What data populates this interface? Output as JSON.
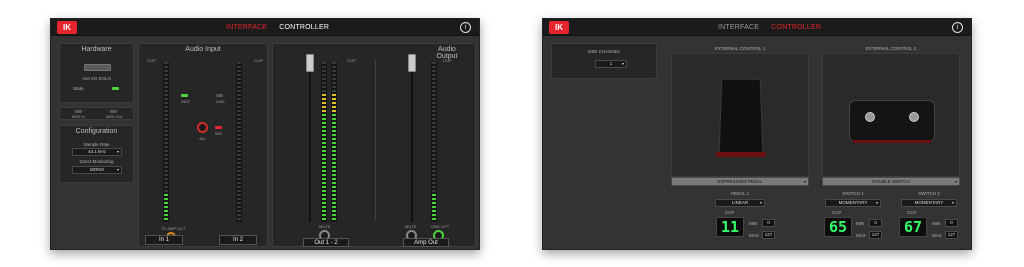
{
  "left_window": {
    "tabs": {
      "interface": "INTERFACE",
      "controller": "CONTROLLER"
    },
    "info_icon": "i",
    "hardware": {
      "title": "Hardware",
      "device_name": "Axe I/O SOLO",
      "state_label": "State",
      "midi_in": "MIDI In",
      "midi_out": "MIDI Out"
    },
    "configuration": {
      "title": "Configuration",
      "sample_rate_label": "Sample Rate",
      "sample_rate_value": "44.1 kHz",
      "direct_monitoring_label": "Direct Monitoring",
      "direct_monitoring_value": "MONO"
    },
    "audio_input": {
      "title": "Audio Input",
      "clip": "CLIP",
      "scale": [
        "0",
        "-6",
        "-12",
        "-20",
        "-40",
        "-60"
      ],
      "inst": "INST",
      "line": "LINE",
      "mic": "MIC",
      "plus48v": "48v",
      "to_amp_out": "TO AMP OUT",
      "in1": "In 1",
      "in2": "In 2"
    },
    "audio_output": {
      "title": "Audio Output",
      "clip": "CLIP",
      "scale": [
        "0",
        "-6",
        "-12",
        "-18",
        "-30",
        "-48",
        "-60"
      ],
      "mute": "MUTE",
      "mute2": "MUTE",
      "gnd_lift": "GND LIFT",
      "out12": "Out 1 - 2",
      "amp_out": "Amp Out"
    }
  },
  "right_window": {
    "tabs": {
      "interface": "INTERFACE",
      "controller": "CONTROLLER"
    },
    "info_icon": "i",
    "midi_channel_label": "MIDI CHANNEL",
    "midi_channel_value": "1",
    "external_control_1": {
      "title": "EXTERNAL CONTROL 1",
      "device": "EXPRESSION PEDAL",
      "pedal_label": "PEDAL 1",
      "pedal_mode": "LINEAR",
      "cc_label": "CC#",
      "cc_value": "11",
      "min_label": "MIN",
      "min_value": "0",
      "max_label": "MAX",
      "max_value": "127"
    },
    "external_control_2": {
      "title": "EXTERNAL CONTROL 2",
      "device": "DOUBLE SWITCH",
      "switch1": {
        "label": "SWITCH 1",
        "mode": "MOMENTARY",
        "cc_label": "CC#",
        "cc_value": "65",
        "min_label": "MIN",
        "min_value": "0",
        "max_label": "MAX",
        "max_value": "127"
      },
      "switch2": {
        "label": "SWITCH 2",
        "mode": "MOMENTARY",
        "cc_label": "CC#",
        "cc_value": "67",
        "min_label": "MIN",
        "min_value": "0",
        "max_label": "MAX",
        "max_value": "127"
      }
    }
  },
  "colors": {
    "accent_red": "#e3262e",
    "meter_green": "#4bd43b",
    "meter_yellow": "#e0c02a",
    "lcd_green": "#33ff66",
    "knob_orange": "#e08a1e",
    "led_green": "#4bd43b"
  }
}
